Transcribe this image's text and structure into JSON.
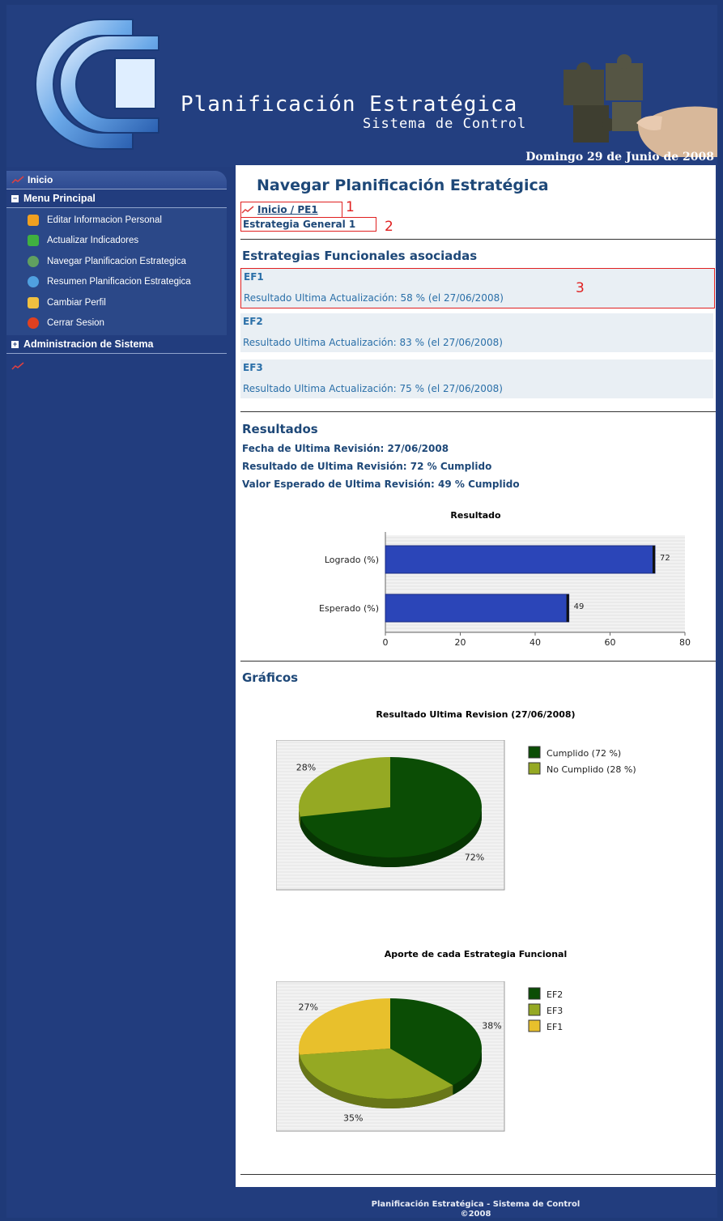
{
  "header": {
    "title": "Planificación Estratégica",
    "subtitle": "Sistema de Control",
    "date": "Domingo 29 de Junio de 2008"
  },
  "sidebar": {
    "inicio": "Inicio",
    "menu_principal": "Menu Principal",
    "items": [
      {
        "label": "Editar Informacion Personal",
        "icon": "edit-user-icon",
        "color": "#f0a020"
      },
      {
        "label": "Actualizar Indicadores",
        "icon": "hierarchy-icon",
        "color": "#40b040"
      },
      {
        "label": "Navegar Planificacion Estrategica",
        "icon": "globe-icon",
        "color": "#60a060"
      },
      {
        "label": "Resumen Planificacion Estrategica",
        "icon": "pie-icon",
        "color": "#50a0e0"
      },
      {
        "label": "Cambiar Perfil",
        "icon": "folder-user-icon",
        "color": "#f0c040"
      },
      {
        "label": "Cerrar Sesion",
        "icon": "power-icon",
        "color": "#e04020"
      }
    ],
    "admin": "Administracion de Sistema"
  },
  "main": {
    "page_title": "Navegar Planificación Estratégica",
    "breadcrumb": "Inicio / PE1",
    "strategy": "Estrategia General 1",
    "annotations": [
      "1",
      "2",
      "3"
    ],
    "ef_heading": "Estrategias Funcionales asociadas",
    "ef_items": [
      {
        "name": "EF1",
        "result": "Resultado Ultima Actualización: 58 % (el 27/06/2008)"
      },
      {
        "name": "EF2",
        "result": "Resultado Ultima Actualización: 83 % (el 27/06/2008)"
      },
      {
        "name": "EF3",
        "result": "Resultado Ultima Actualización: 75 % (el 27/06/2008)"
      }
    ],
    "resultados_heading": "Resultados",
    "fecha": "Fecha de Ultima Revisión: 27/06/2008",
    "resultado": "Resultado de Ultima Revisión: 72 % Cumplido",
    "esperado": "Valor Esperado de Ultima Revisión: 49 % Cumplido",
    "graficos_heading": "Gráficos"
  },
  "chart_data": [
    {
      "type": "bar",
      "title": "Resultado",
      "categories": [
        "Logrado (%)",
        "Esperado (%)"
      ],
      "values": [
        72,
        49
      ],
      "xlim": [
        0,
        80
      ],
      "ticks": [
        0,
        20,
        40,
        60,
        80
      ],
      "color": "#2b45b8"
    },
    {
      "type": "pie",
      "title": "Resultado Ultima Revision (27/06/2008)",
      "labels": [
        "Cumplido (72 %)",
        "No Cumplido (28 %)"
      ],
      "values": [
        72,
        28
      ],
      "slice_labels": [
        "72%",
        "28%"
      ],
      "colors": [
        "#0b4d05",
        "#95a923"
      ]
    },
    {
      "type": "pie",
      "title": "Aporte de cada Estrategia Funcional",
      "labels": [
        "EF2",
        "EF3",
        "EF1"
      ],
      "values": [
        38,
        35,
        27
      ],
      "slice_labels": [
        "38%",
        "35%",
        "27%"
      ],
      "colors": [
        "#0b4d05",
        "#95a923",
        "#e8c02c"
      ]
    }
  ],
  "footer": {
    "line1": "Planificación Estratégica - Sistema de Control",
    "line2": "©2008"
  }
}
